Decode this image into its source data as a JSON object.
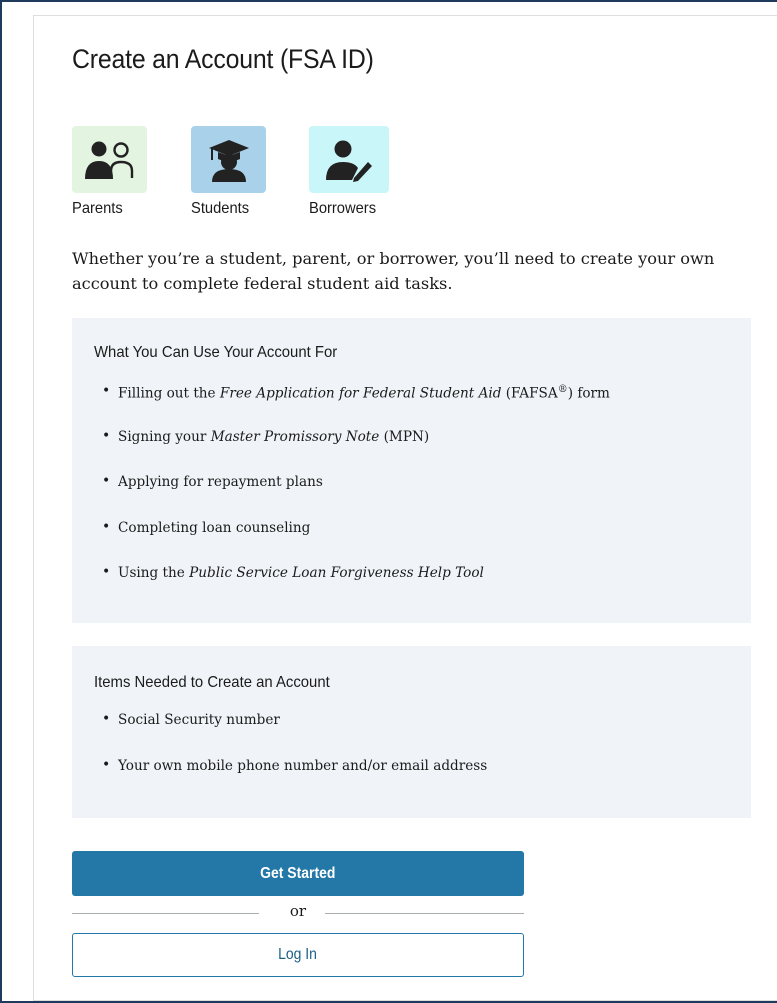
{
  "page": {
    "title": "Create an Account (FSA ID)",
    "intro": "Whether you’re a student, parent, or borrower, you’ll need to create your own account to complete federal student aid tasks."
  },
  "personas": [
    {
      "label": "Parents",
      "icon": "parents-icon",
      "bg": "#e3f5e1"
    },
    {
      "label": "Students",
      "icon": "graduate-icon",
      "bg": "#a9d2ea"
    },
    {
      "label": "Borrowers",
      "icon": "borrower-icon",
      "bg": "#c9f6f9"
    }
  ],
  "uses": {
    "heading": "What You Can Use Your Account For",
    "items": [
      {
        "pre": "Filling out the ",
        "em": "Free Application for Federal Student Aid",
        "post": " (FAFSA",
        "sup": "®",
        "post2": ") form"
      },
      {
        "pre": "Signing your ",
        "em": "Master Promissory Note",
        "post": " (MPN)",
        "sup": "",
        "post2": ""
      },
      {
        "pre": "Applying for repayment plans",
        "em": "",
        "post": "",
        "sup": "",
        "post2": ""
      },
      {
        "pre": "Completing loan counseling",
        "em": "",
        "post": "",
        "sup": "",
        "post2": ""
      },
      {
        "pre": "Using the ",
        "em": "Public Service Loan Forgiveness Help Tool",
        "post": "",
        "sup": "",
        "post2": ""
      }
    ]
  },
  "needed": {
    "heading": "Items Needed to Create an Account",
    "items": [
      "Social Security number",
      "Your own mobile phone number and/or email address"
    ]
  },
  "actions": {
    "primary_label": "Get Started",
    "divider_label": "or",
    "secondary_label": "Log In"
  },
  "colors": {
    "primary": "#2378a7",
    "panel_bg": "#f0f4f8",
    "frame": "#1f3a5c"
  }
}
